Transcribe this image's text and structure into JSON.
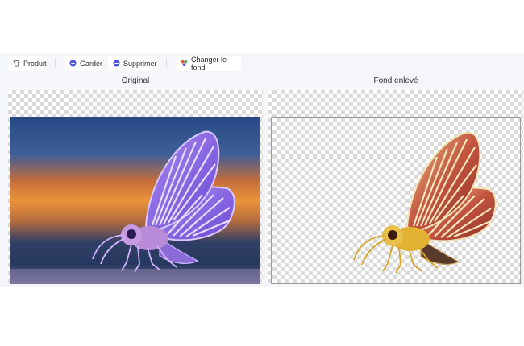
{
  "toolbar": {
    "product_label": "Produit",
    "keep_label": "Garder",
    "delete_label": "Supprimer",
    "change_bg_label": "Changer le fond"
  },
  "panels": {
    "original_title": "Original",
    "result_title": "Fond enlevé"
  },
  "colors": {
    "accent": "#4b55d6",
    "toolbar_bg": "#f5f6fa",
    "moth_wing": "#8a5ae0",
    "moth_body": "#e3b232"
  }
}
